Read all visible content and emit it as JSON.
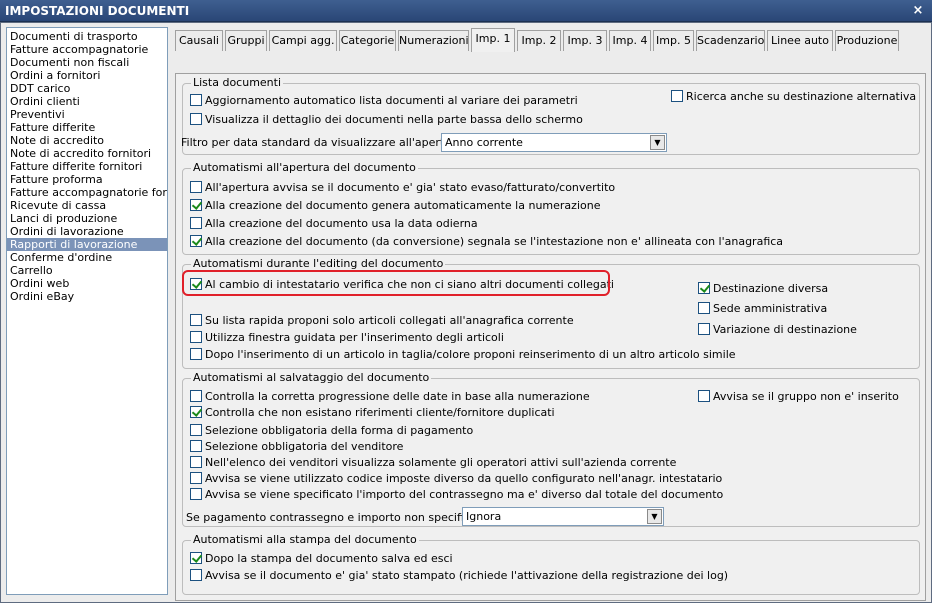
{
  "window": {
    "title": "IMPOSTAZIONI DOCUMENTI",
    "close": "×"
  },
  "left_list": [
    "Documenti di trasporto",
    "Fatture accompagnatorie",
    "Documenti non fiscali",
    "Ordini a fornitori",
    "DDT carico",
    "Ordini clienti",
    "Preventivi",
    "Fatture differite",
    "Note di accredito",
    "Note di accredito fornitori",
    "Fatture differite fornitori",
    "Fatture proforma",
    "Fatture accompagnatorie fornitori",
    "Ricevute di cassa",
    "Lanci di produzione",
    "Ordini di lavorazione",
    "Rapporti di lavorazione",
    "Conferme d'ordine",
    "Carrello",
    "Ordini web",
    "Ordini eBay"
  ],
  "left_selected_index": 16,
  "tabs": [
    "Causali",
    "Gruppi",
    "Campi agg.",
    "Categorie",
    "Numerazioni",
    "Imp. 1",
    "Imp. 2",
    "Imp. 3",
    "Imp. 4",
    "Imp. 5",
    "Scadenzario",
    "Linee auto",
    "Produzione"
  ],
  "active_tab_index": 5,
  "lista": {
    "title": "Lista documenti",
    "cb1": "Aggiornamento automatico lista documenti al variare dei parametri",
    "cb2": "Visualizza il dettaglio dei documenti nella parte bassa dello schermo",
    "cb3": "Ricerca anche su destinazione alternativa",
    "filter_label": "Filtro per data standard da visualizzare all'apertura :",
    "filter_value": "Anno corrente"
  },
  "apertura": {
    "title": "Automatismi all'apertura del documento",
    "cb1": "All'apertura avvisa se il documento e' gia' stato evaso/fatturato/convertito",
    "cb2": "Alla creazione del documento genera automaticamente la numerazione",
    "cb3": "Alla creazione del documento usa la data odierna",
    "cb4": "Alla creazione del documento (da conversione) segnala se l'intestazione non e' allineata con l'anagrafica"
  },
  "editing": {
    "title": "Automatismi durante l'editing del documento",
    "cb1": "Al cambio di intestatario verifica che non ci siano altri documenti collegati",
    "cb2": "Su lista rapida proponi solo articoli collegati all'anagrafica corrente",
    "cb3": "Utilizza finestra guidata per l'inserimento degli articoli",
    "cb4": "Dopo l'inserimento di un articolo in taglia/colore proponi reinserimento di un altro articolo simile",
    "r1": "Destinazione diversa",
    "r2": "Sede amministrativa",
    "r3": "Variazione di destinazione"
  },
  "salvataggio": {
    "title": "Automatismi al salvataggio del documento",
    "cb1": "Controlla la corretta progressione delle date in base alla numerazione",
    "cb2": "Controlla che non esistano riferimenti cliente/fornitore duplicati",
    "cb3": "Selezione obbligatoria della forma di pagamento",
    "cb4": "Selezione obbligatoria del venditore",
    "cb5": "Nell'elenco dei venditori visualizza solamente gli operatori attivi sull'azienda corrente",
    "cb6": "Avvisa se viene utilizzato codice imposte diverso da quello configurato nell'anagr. intestatario",
    "cb7": "Avvisa se viene specificato l'importo del contrassegno ma e' diverso dal totale del documento",
    "cb8": "Avvisa se il gruppo non e' inserito",
    "contr_label": "Se pagamento contrassegno e importo non specificato :",
    "contr_value": "Ignora"
  },
  "stampa": {
    "title": "Automatismi alla stampa del documento",
    "cb1": "Dopo la stampa del documento salva ed esci",
    "cb2": "Avvisa se il documento e' gia' stato stampato (richiede l'attivazione della registrazione dei log)"
  },
  "checked": {
    "apertura_cb2": true,
    "apertura_cb4": true,
    "editing_cb1": true,
    "editing_r1": true,
    "salvataggio_cb2": true,
    "stampa_cb1": true
  }
}
